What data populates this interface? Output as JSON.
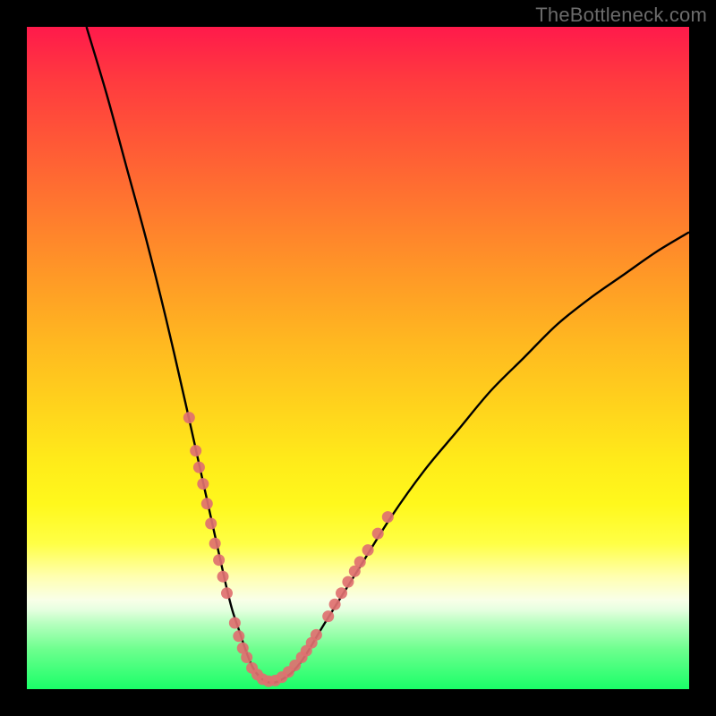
{
  "watermark": "TheBottleneck.com",
  "colors": {
    "frame": "#000000",
    "curve": "#000000",
    "marker": "#e07070",
    "gradient_top": "#ff1a4b",
    "gradient_bottom": "#1aff68"
  },
  "chart_data": {
    "type": "line",
    "title": "",
    "xlabel": "",
    "ylabel": "",
    "xlim": [
      0,
      100
    ],
    "ylim": [
      0,
      100
    ],
    "series": [
      {
        "name": "bottleneck-curve",
        "x": [
          9,
          12,
          15,
          18,
          21,
          24,
          26,
          28,
          30,
          31,
          32,
          33,
          34,
          35,
          36,
          37,
          38,
          40,
          42,
          45,
          50,
          55,
          60,
          65,
          70,
          75,
          80,
          85,
          90,
          95,
          100
        ],
        "values": [
          100,
          90,
          79,
          68,
          56,
          43,
          34,
          25,
          16,
          12,
          9,
          6,
          3.5,
          2,
          1.2,
          1,
          1.2,
          2.5,
          5,
          10,
          18,
          26,
          33,
          39,
          45,
          50,
          55,
          59,
          62.5,
          66,
          69
        ]
      }
    ],
    "markers": [
      {
        "x": 24.5,
        "y": 41
      },
      {
        "x": 25.5,
        "y": 36
      },
      {
        "x": 26,
        "y": 33.5
      },
      {
        "x": 26.6,
        "y": 31
      },
      {
        "x": 27.2,
        "y": 28
      },
      {
        "x": 27.8,
        "y": 25
      },
      {
        "x": 28.4,
        "y": 22
      },
      {
        "x": 29,
        "y": 19.5
      },
      {
        "x": 29.6,
        "y": 17
      },
      {
        "x": 30.2,
        "y": 14.5
      },
      {
        "x": 31.4,
        "y": 10
      },
      {
        "x": 32,
        "y": 8
      },
      {
        "x": 32.6,
        "y": 6.2
      },
      {
        "x": 33.2,
        "y": 4.8
      },
      {
        "x": 34,
        "y": 3.2
      },
      {
        "x": 34.8,
        "y": 2.2
      },
      {
        "x": 35.6,
        "y": 1.5
      },
      {
        "x": 36.5,
        "y": 1.2
      },
      {
        "x": 37.5,
        "y": 1.3
      },
      {
        "x": 38.5,
        "y": 1.8
      },
      {
        "x": 39.5,
        "y": 2.6
      },
      {
        "x": 40.5,
        "y": 3.6
      },
      {
        "x": 41.5,
        "y": 4.8
      },
      {
        "x": 42.2,
        "y": 5.8
      },
      {
        "x": 43,
        "y": 7
      },
      {
        "x": 43.7,
        "y": 8.2
      },
      {
        "x": 45.5,
        "y": 11
      },
      {
        "x": 46.5,
        "y": 12.8
      },
      {
        "x": 47.5,
        "y": 14.5
      },
      {
        "x": 48.5,
        "y": 16.2
      },
      {
        "x": 49.5,
        "y": 17.8
      },
      {
        "x": 50.3,
        "y": 19.2
      },
      {
        "x": 51.5,
        "y": 21
      },
      {
        "x": 53,
        "y": 23.5
      },
      {
        "x": 54.5,
        "y": 26
      }
    ]
  }
}
